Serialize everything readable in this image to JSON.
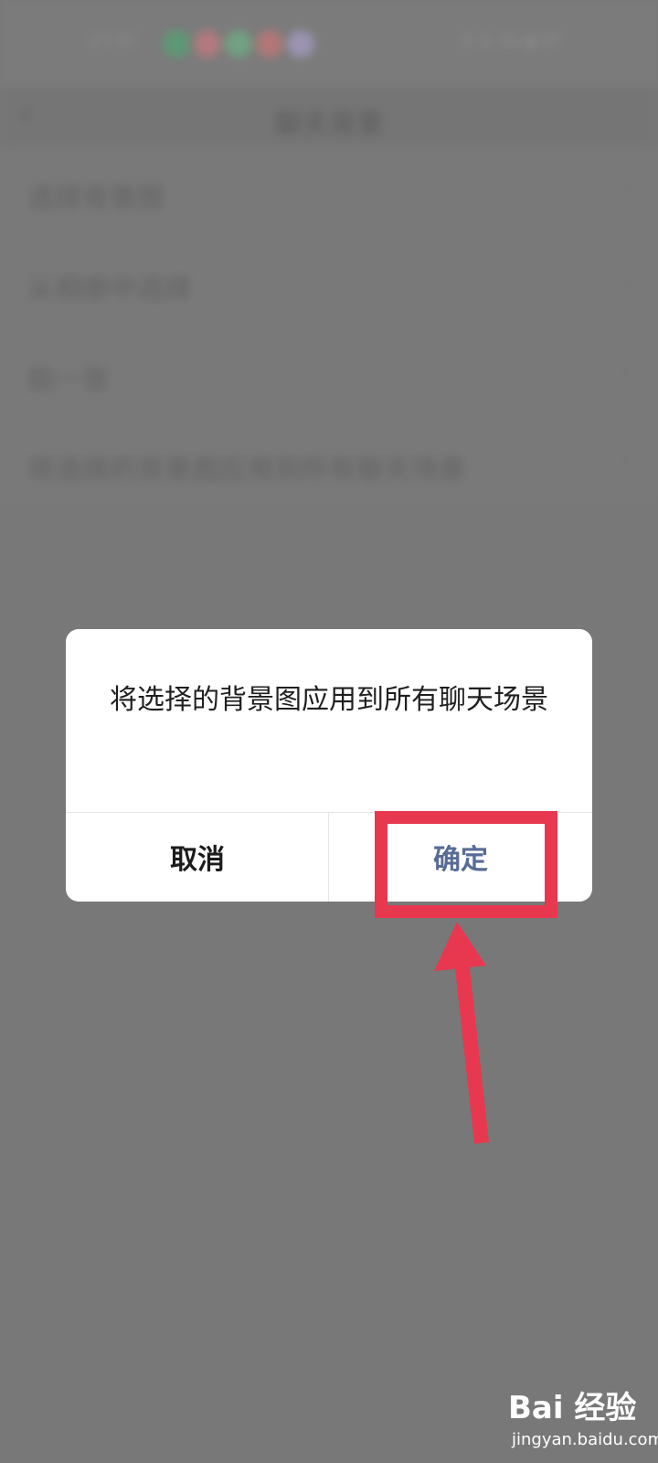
{
  "status_bar": {
    "time": "17:57",
    "dot_colors": [
      "#57a779",
      "#c77e85",
      "#73b189",
      "#c87a7a",
      "#a9a0c8"
    ],
    "right_text": "⚲ ◎ 5G ▮ 37"
  },
  "nav": {
    "back_icon": "chevron-left-icon",
    "title": "聊天背景"
  },
  "menu": {
    "items": [
      {
        "label": "选择背景图"
      },
      {
        "label": "从相册中选择"
      },
      {
        "label": "拍一张"
      },
      {
        "label": "将选择的背景图应用到所有聊天场景"
      }
    ],
    "chevron": "›"
  },
  "dialog": {
    "message": "将选择的背景图应用到所有聊天场景",
    "cancel_label": "取消",
    "ok_label": "确定"
  },
  "annotation": {
    "color": "#e8384f"
  },
  "watermark": {
    "brand": "Bai 经验",
    "url": "jingyan.baidu.com"
  }
}
